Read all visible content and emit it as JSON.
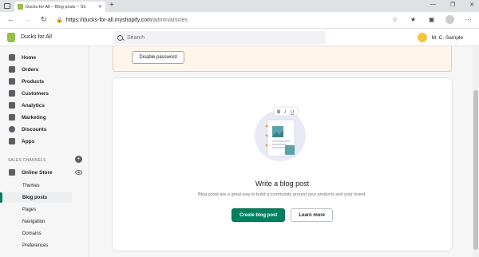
{
  "browser": {
    "tab_title": "Ducks for All ~ Blog posts ~ Sh",
    "url_host": "https://ducks-for-all.myshopify.com",
    "url_path": "/admin/articles"
  },
  "topbar": {
    "store_name": "Ducks for All",
    "search_placeholder": "Search",
    "user_name": "M. C. Sample"
  },
  "sidebar": {
    "items": [
      {
        "label": "Home",
        "icon": "home-icon"
      },
      {
        "label": "Orders",
        "icon": "orders-icon"
      },
      {
        "label": "Products",
        "icon": "tag-icon"
      },
      {
        "label": "Customers",
        "icon": "person-icon"
      },
      {
        "label": "Analytics",
        "icon": "bar-chart-icon"
      },
      {
        "label": "Marketing",
        "icon": "megaphone-icon"
      },
      {
        "label": "Discounts",
        "icon": "discount-icon"
      },
      {
        "label": "Apps",
        "icon": "apps-icon"
      }
    ],
    "channels_heading": "SALES CHANNELS",
    "online_store": "Online Store",
    "sub_items": [
      {
        "label": "Themes"
      },
      {
        "label": "Blog posts"
      },
      {
        "label": "Pages"
      },
      {
        "label": "Navigation"
      },
      {
        "label": "Domains"
      },
      {
        "label": "Preferences"
      }
    ],
    "active_sub_item": "Blog posts"
  },
  "banner": {
    "button_label": "Disable password"
  },
  "empty_state": {
    "title": "Write a blog post",
    "description": "Blog posts are a great way to build a community around your products and your brand.",
    "primary_button": "Create blog post",
    "secondary_button": "Learn more"
  },
  "colors": {
    "primary": "#008060",
    "brand": "#95bf47",
    "banner_bg": "#fff5ea"
  }
}
